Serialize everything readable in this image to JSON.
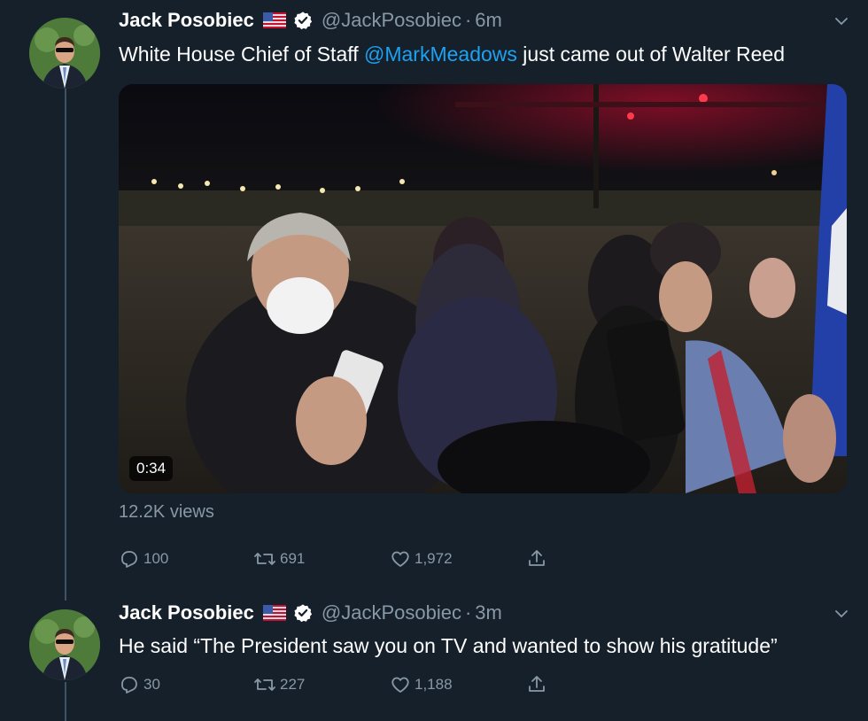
{
  "tweets": [
    {
      "name": "Jack Posobiec",
      "handle": "@JackPosobiec",
      "time": "6m",
      "text_before": "White House Chief of Staff ",
      "mention": "@MarkMeadows",
      "text_after": " just came out of Walter Reed",
      "video_duration": "0:34",
      "views": "12.2K views",
      "replies": "100",
      "retweets": "691",
      "likes": "1,972"
    },
    {
      "name": "Jack Posobiec",
      "handle": "@JackPosobiec",
      "time": "3m",
      "text": "He said “The President saw you on TV and wanted to show his gratitude”",
      "replies": "30",
      "retweets": "227",
      "likes": "1,188"
    }
  ],
  "separator_dot": "·",
  "colors": {
    "background": "#15202b",
    "secondary": "#8899a6",
    "link": "#1da1f2",
    "thread_line": "#3d5466"
  },
  "icons": [
    "verified-badge-icon",
    "us-flag-icon",
    "chevron-down-icon",
    "reply-icon",
    "retweet-icon",
    "like-icon",
    "share-icon"
  ]
}
